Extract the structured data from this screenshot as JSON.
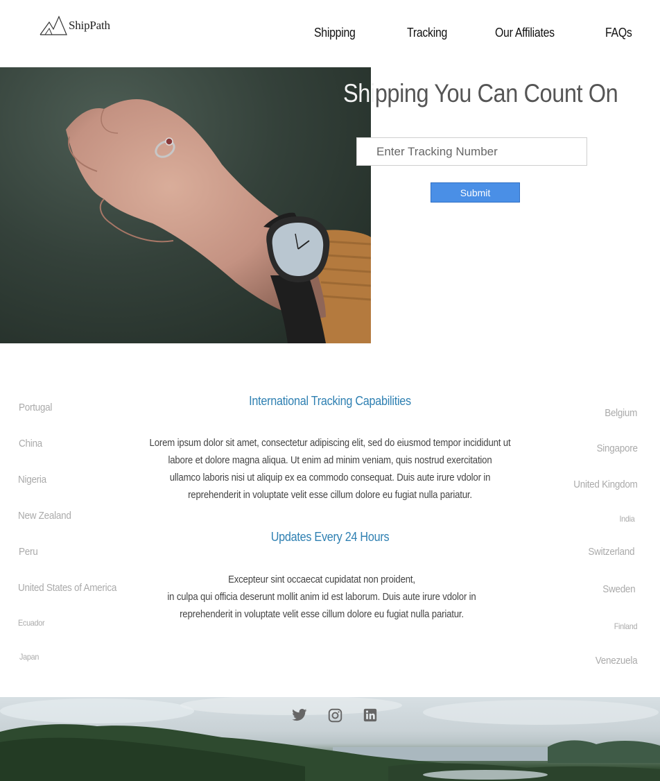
{
  "brand": {
    "name": "ShipPath"
  },
  "nav": {
    "shipping": "Shipping",
    "tracking": "Tracking",
    "affiliates": "Our Affiliates",
    "faqs": "FAQs"
  },
  "hero": {
    "title_over_image": "Shi",
    "title_rest": "pping You Can Count On",
    "input_placeholder": "Enter Tracking Number",
    "submit_label": "Submit"
  },
  "countries_left": [
    "Portugal",
    "China",
    "Nigeria",
    "New Zealand",
    "Peru",
    "United States of America",
    "Ecuador",
    "Japan"
  ],
  "countries_right": [
    "Belgium",
    "Singapore",
    "United Kingdom",
    "India",
    "Switzerland",
    "Sweden",
    "Finland",
    "Venezuela"
  ],
  "content": {
    "section1_title": "International Tracking Capabilities",
    "section1_lines": [
      "Lorem ipsum dolor sit amet, consectetur adipiscing elit, sed do eiusmod tempor incididunt ut",
      "labore et dolore magna aliqua. Ut enim ad minim veniam, quis nostrud exercitation",
      "ullamco laboris nisi ut aliquip ex ea commodo consequat. Duis aute irure vdolor in",
      "reprehenderit in voluptate velit esse cillum dolore eu fugiat nulla pariatur."
    ],
    "section2_title": "Updates Every 24 Hours",
    "section2_lines": [
      "Excepteur sint occaecat cupidatat non proident,",
      "in culpa qui officia deserunt mollit anim id est laborum. Duis aute irure vdolor in",
      "reprehenderit in voluptate velit esse cillum dolore eu fugiat nulla pariatur."
    ]
  },
  "social": {
    "icons": [
      "twitter-icon",
      "instagram-icon",
      "linkedin-icon"
    ],
    "color": "#666666"
  },
  "colors": {
    "accent": "#2f80b2",
    "button": "#4a8fe6"
  }
}
